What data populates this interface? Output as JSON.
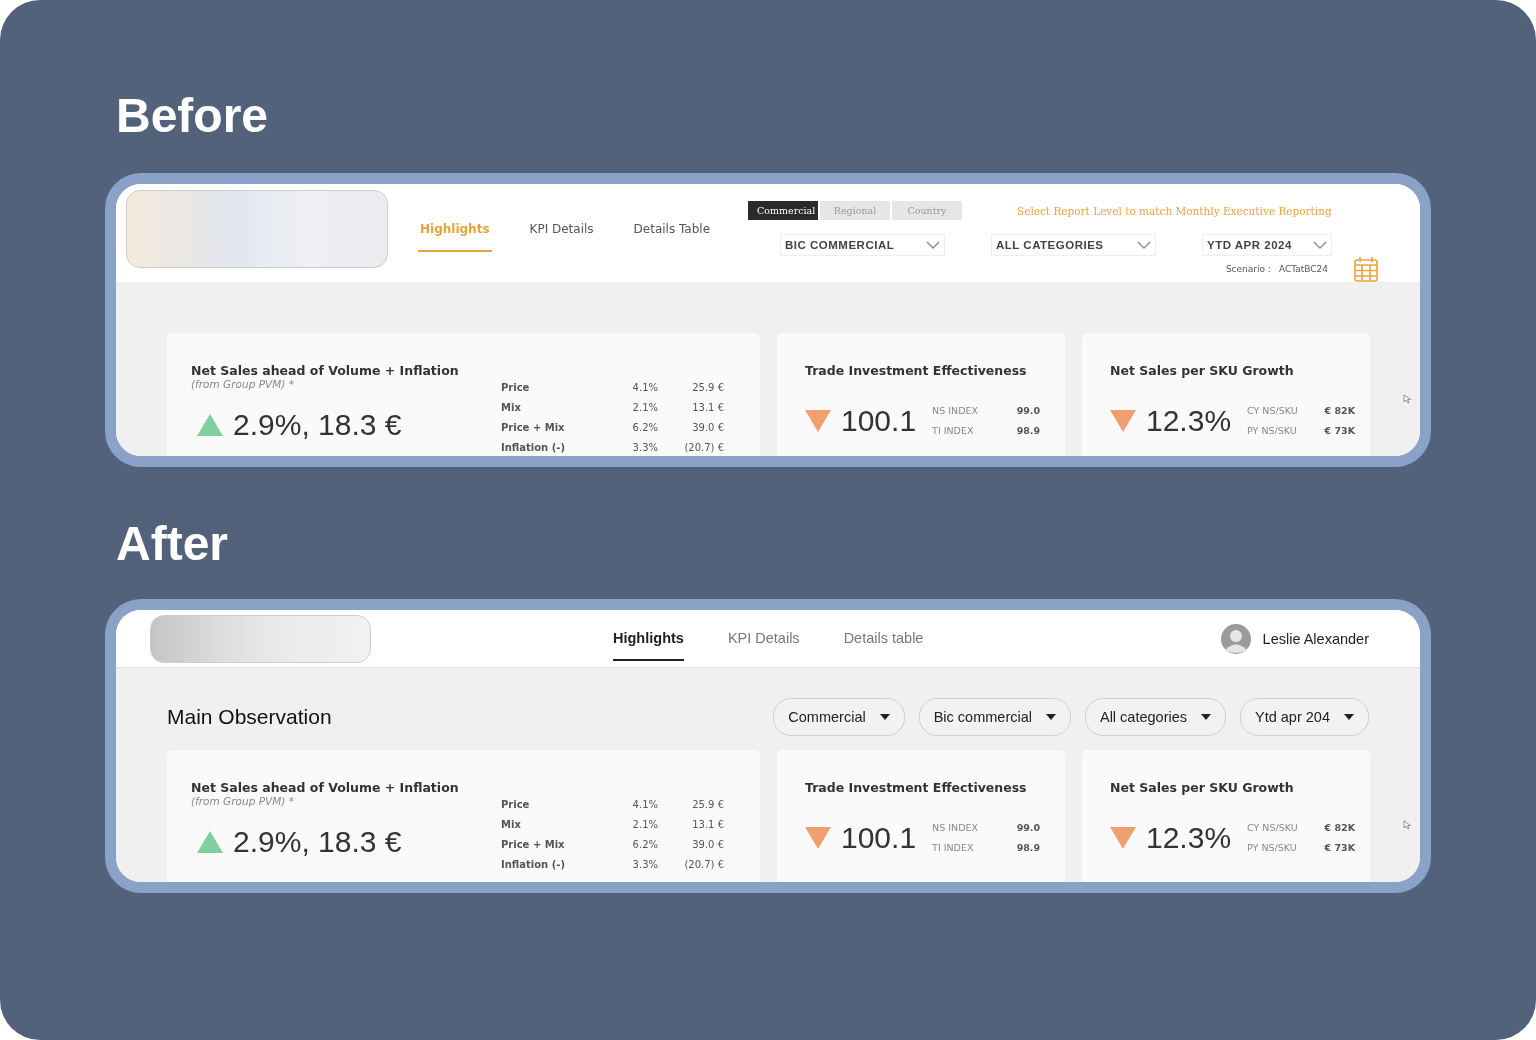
{
  "before": {
    "heading": "Before",
    "tabs": [
      {
        "label": "Highlights",
        "selected": true
      },
      {
        "label": "KPI Details",
        "selected": false
      },
      {
        "label": "Details Table",
        "selected": false
      }
    ],
    "levels": [
      {
        "label": "Commercial",
        "selected": true
      },
      {
        "label": "Regional",
        "selected": false
      },
      {
        "label": "Country",
        "selected": false
      }
    ],
    "hint": "Select Report Level to match Monthly Executive Reporting",
    "dropdowns": [
      "BIC COMMERCIAL",
      "ALL CATEGORIES",
      "YTD APR 2024"
    ],
    "scenario": {
      "label": "Scenario :",
      "value": "ACTatBC24"
    },
    "cards": [
      {
        "kind": "breakdown",
        "title": "Net Sales ahead of Volume + Inflation",
        "subtitle": "(from Group PVM) *",
        "rising": true,
        "value": "2.9%, 18.3 €",
        "rows": [
          {
            "label": "Price",
            "percent": "4.1%",
            "amount": "25.9 €"
          },
          {
            "label": "Mix",
            "percent": "2.1%",
            "amount": "13.1 €"
          },
          {
            "label": "Price + Mix",
            "percent": "6.2%",
            "amount": "39.0 €"
          },
          {
            "label": "Inflation (-)",
            "percent": "3.3%",
            "amount": "(20.7) €"
          }
        ]
      },
      {
        "kind": "indices",
        "title": "Trade Investment Effectiveness",
        "rising": false,
        "value": "100.1",
        "rows": [
          {
            "label": "NS INDEX",
            "value": "99.0"
          },
          {
            "label": "TI INDEX",
            "value": "98.9"
          }
        ]
      },
      {
        "kind": "indices",
        "title": "Net Sales per SKU Growth",
        "rising": false,
        "value": "12.3%",
        "rows": [
          {
            "label": "CY NS/SKU",
            "value": "€ 82K"
          },
          {
            "label": "PY NS/SKU",
            "value": "€ 73K"
          }
        ]
      }
    ]
  },
  "after": {
    "heading": "After",
    "tabs": [
      {
        "label": "Highlights",
        "selected": true
      },
      {
        "label": "KPI Details",
        "selected": false
      },
      {
        "label": "Details table",
        "selected": false
      }
    ],
    "user": {
      "name": "Leslie Alexander"
    },
    "section_title": "Main Observation",
    "filters": [
      "Commercial",
      "Bic commercial",
      "All categories",
      "Ytd apr 204"
    ],
    "cards": [
      {
        "kind": "breakdown",
        "title": "Net Sales ahead of Volume + Inflation",
        "subtitle": "(from Group PVM) *",
        "rising": true,
        "value": "2.9%, 18.3 €",
        "rows": [
          {
            "label": "Price",
            "percent": "4.1%",
            "amount": "25.9 €"
          },
          {
            "label": "Mix",
            "percent": "2.1%",
            "amount": "13.1 €"
          },
          {
            "label": "Price + Mix",
            "percent": "6.2%",
            "amount": "39.0 €"
          },
          {
            "label": "Inflation (-)",
            "percent": "3.3%",
            "amount": "(20.7) €"
          }
        ]
      },
      {
        "kind": "indices",
        "title": "Trade Investment Effectiveness",
        "rising": false,
        "value": "100.1",
        "rows": [
          {
            "label": "NS INDEX",
            "value": "99.0"
          },
          {
            "label": "TI INDEX",
            "value": "98.9"
          }
        ]
      },
      {
        "kind": "indices",
        "title": "Net Sales per SKU Growth",
        "rising": false,
        "value": "12.3%",
        "rows": [
          {
            "label": "CY NS/SKU",
            "value": "€ 82K"
          },
          {
            "label": "PY NS/SKU",
            "value": "€ 73K"
          }
        ]
      }
    ]
  }
}
